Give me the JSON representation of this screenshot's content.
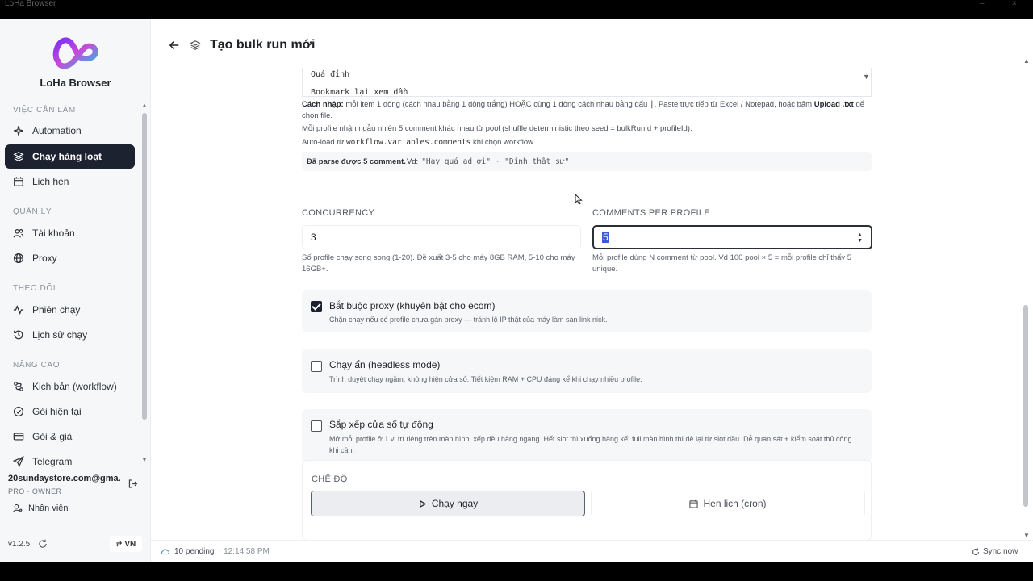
{
  "window": {
    "title": "LoHa Browser"
  },
  "sidebar": {
    "brand": "LoHa Browser",
    "sections": {
      "todo": "VIỆC CẦN LÀM",
      "manage": "QUẢN LÝ",
      "monitor": "THEO DÕI",
      "advanced": "NÂNG CAO"
    },
    "items": [
      {
        "label": "Automation"
      },
      {
        "label": "Chạy hàng loạt"
      },
      {
        "label": "Lịch hẹn"
      },
      {
        "label": "Tài khoản"
      },
      {
        "label": "Proxy"
      },
      {
        "label": "Phiên chạy"
      },
      {
        "label": "Lịch sử chạy"
      },
      {
        "label": "Kịch bản (workflow)"
      },
      {
        "label": "Gói hiện tại"
      },
      {
        "label": "Gói & giá"
      },
      {
        "label": "Telegram"
      }
    ],
    "active_index": 1,
    "account": "20sundaystore.com@gma...",
    "plan": "PRO · OWNER",
    "staff": "Nhân viên",
    "version": "v1.2.5",
    "lang": "VN"
  },
  "header": {
    "title": "Tạo bulk run mới"
  },
  "comments": {
    "lines": [
      "Quá đỉnh",
      "Bookmark lại xem dần"
    ],
    "help1_a": "Cách nhập:",
    "help1_b": " mỗi item 1 dòng (cách nhau bằng 1 dòng trắng) HOẶC cùng 1 dòng cách nhau bằng dấu ",
    "help1_sep": "|",
    "help1_c": ". Paste trực tiếp từ Excel / Notepad, hoặc bấm ",
    "help1_upload": "Upload .txt",
    "help1_d": " để chọn file.",
    "help2": "Mỗi profile nhận ngẫu nhiên 5 comment khác nhau từ pool (shuffle deterministic theo seed = bulkRunId + profileId).",
    "help3_a": "Auto-load từ ",
    "help3_code": "workflow.variables.comments",
    "help3_b": " khi chọn workflow.",
    "parsed_a": "Đã parse được 5 comment.",
    "parsed_b": " Vd:",
    "parsed_examples": "\"Hay quá ad ơi\" · \"Đỉnh thật sự\""
  },
  "concurrency": {
    "label": "CONCURRENCY",
    "value": "3",
    "hint": "Số profile chạy song song (1-20). Đề xuất 3-5 cho máy 8GB RAM, 5-10 cho máy 16GB+."
  },
  "comments_per_profile": {
    "label": "COMMENTS PER PROFILE",
    "value": "5",
    "hint": "Mỗi profile dùng N comment từ pool. Vd 100 pool × 5 = mỗi profile chỉ thấy 5 unique."
  },
  "options": [
    {
      "title": "Bắt buộc proxy (khuyên bật cho ecom)",
      "desc": "Chặn chạy nếu có profile chưa gán proxy — tránh lộ IP thật của máy làm sàn link nick.",
      "checked": true
    },
    {
      "title": "Chạy ẩn (headless mode)",
      "desc": "Trình duyệt chạy ngầm, không hiện cửa sổ. Tiết kiệm RAM + CPU đáng kể khi chạy nhiều profile.",
      "checked": false
    },
    {
      "title": "Sắp xếp cửa sổ tự động",
      "desc": "Mở mỗi profile ở 1 vị trí riêng trên màn hình, xếp đều hàng ngang. Hết slot thì xuống hàng kế; full màn hình thì đè lại từ slot đầu. Dễ quan sát + kiểm soát thủ công khi cần.",
      "checked": false
    }
  ],
  "mode": {
    "label": "CHẾ ĐỘ",
    "run_now": "Chạy ngay",
    "schedule": "Hẹn lịch (cron)"
  },
  "footer": {
    "pending": "10 pending",
    "time": "· 12:14:58 PM",
    "sync": "Sync now"
  },
  "colors": {
    "active_nav": "#1c2230",
    "selection": "#3b5bdb",
    "sidebar_bg": "#f6f7f8"
  }
}
